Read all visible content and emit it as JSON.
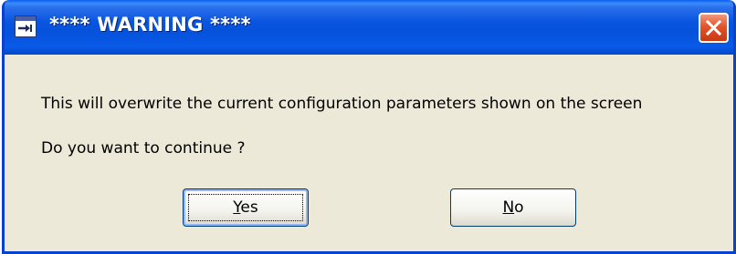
{
  "window": {
    "title": "**** WARNING ****",
    "icon": "app-window-icon",
    "close_icon": "close-x-icon"
  },
  "message": {
    "line1": "This will overwrite the current configuration parameters shown on the screen",
    "line2": "Do you want to continue ?"
  },
  "buttons": {
    "yes": {
      "mnemonic": "Y",
      "rest": "es"
    },
    "no": {
      "mnemonic": "N",
      "rest": "o"
    }
  },
  "colors": {
    "titlebar": "#0552dc",
    "dialog_bg": "#ece9d8",
    "close_button": "#e2542c"
  }
}
